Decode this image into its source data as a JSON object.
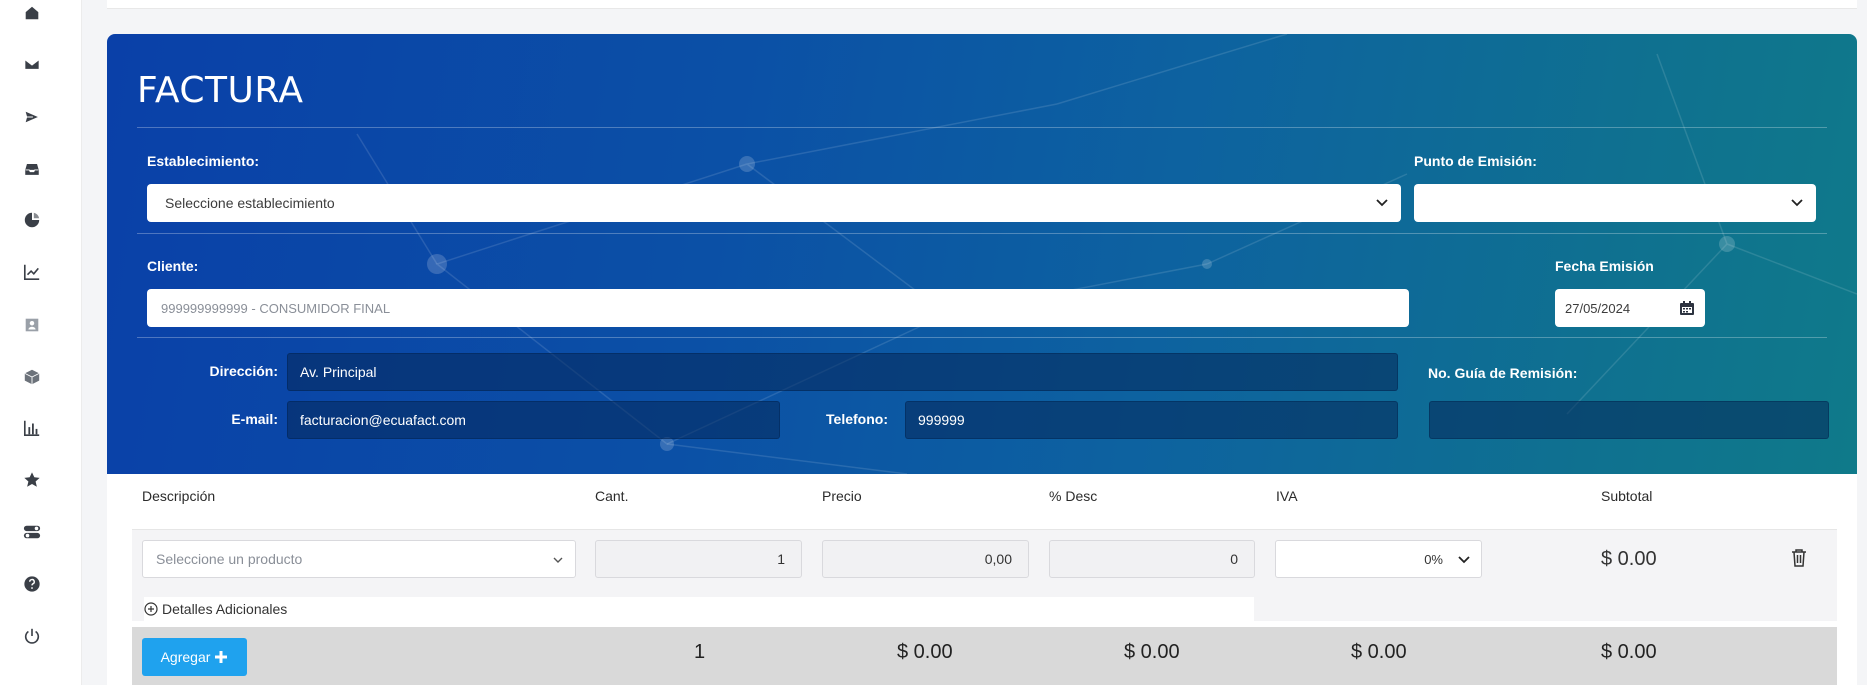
{
  "sidebar": {
    "icons": [
      "home-icon",
      "mail-icon",
      "send-icon",
      "inbox-icon",
      "pie-chart-icon",
      "line-chart-icon",
      "contacts-icon",
      "box-icon",
      "bar-chart-icon",
      "star-icon",
      "toggle-icon",
      "help-icon",
      "power-icon"
    ]
  },
  "header": {
    "title": "FACTURA",
    "establecimiento_label": "Establecimiento:",
    "establecimiento_value": "Seleccione establecimiento",
    "punto_emision_label": "Punto de Emisión:",
    "punto_emision_value": "",
    "cliente_label": "Cliente:",
    "cliente_placeholder": "999999999999 - CONSUMIDOR FINAL",
    "fecha_label": "Fecha Emisión",
    "fecha_value": "27/05/2024",
    "direccion_label": "Dirección:",
    "direccion_value": "Av. Principal",
    "email_label": "E-mail:",
    "email_value": "facturacion@ecuafact.com",
    "telefono_label": "Telefono:",
    "telefono_value": "999999",
    "guia_label": "No. Guía de Remisión:",
    "guia_value": ""
  },
  "table": {
    "columns": [
      "Descripción",
      "Cant.",
      "Precio",
      "% Desc",
      "IVA",
      "Subtotal"
    ],
    "row": {
      "producto_placeholder": "Seleccione un producto",
      "cantidad": "1",
      "precio": "0,00",
      "descuento": "0",
      "iva": "0%",
      "subtotal": "$ 0.00"
    },
    "detalles_label": "Detalles Adicionales",
    "agregar_label": "Agregar",
    "totals": {
      "cantidad": "1",
      "precio": "$ 0.00",
      "descuento": "$ 0.00",
      "iva": "$ 0.00",
      "subtotal": "$ 0.00"
    }
  },
  "colors": {
    "header_start": "#0a40a8",
    "header_end": "#0f7a8a",
    "button": "#1fa2ee"
  }
}
